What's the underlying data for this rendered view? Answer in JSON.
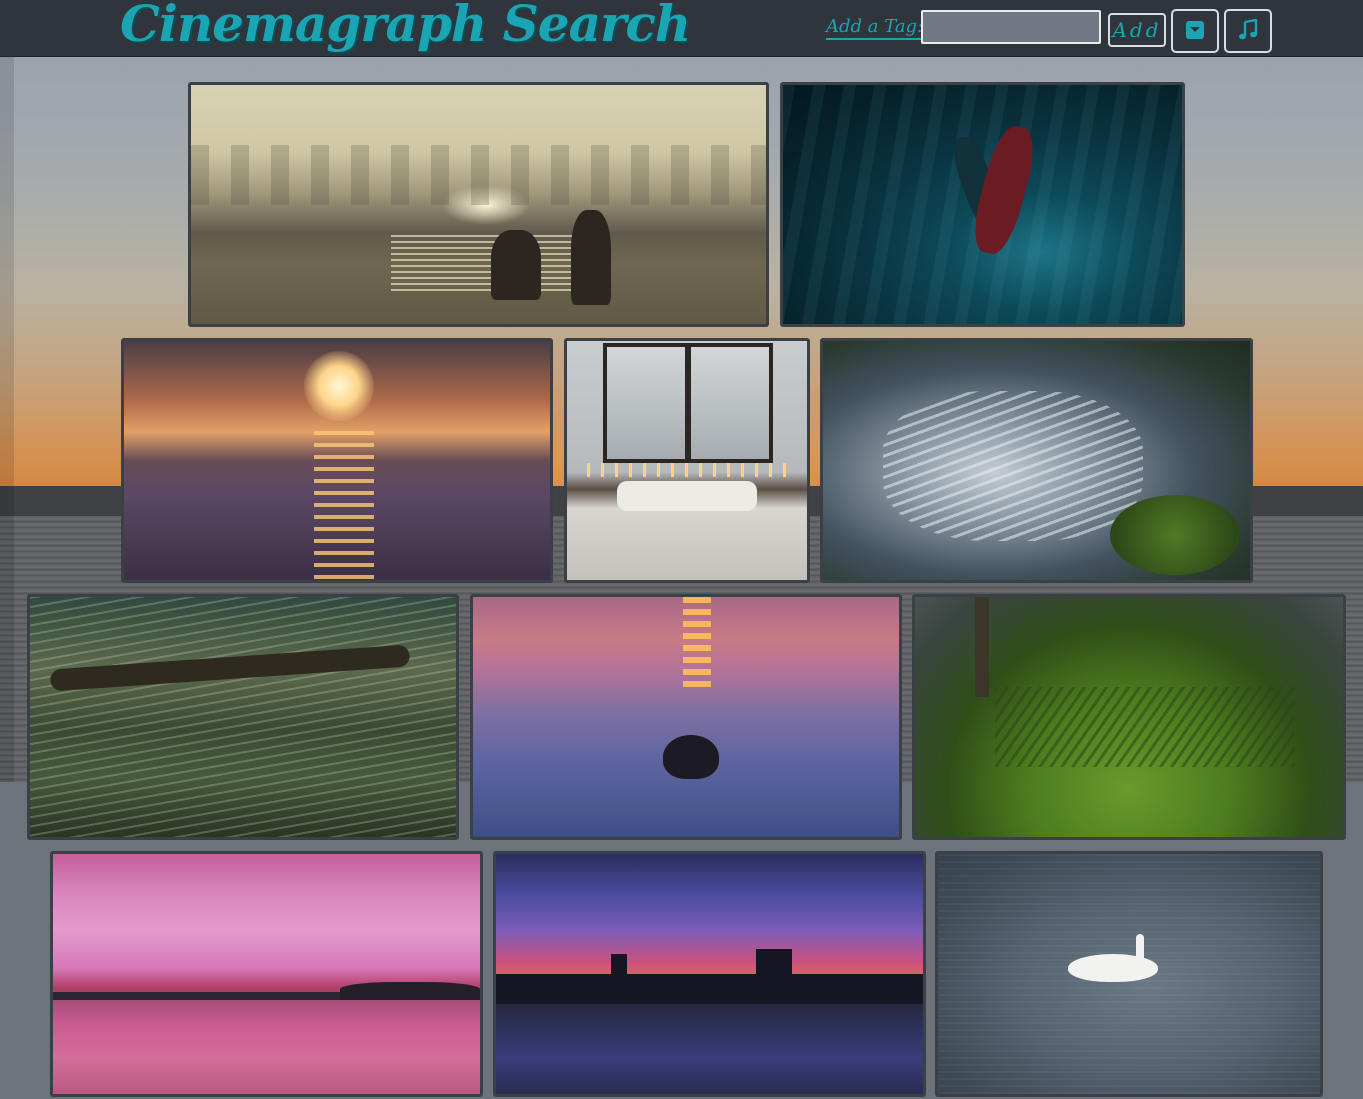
{
  "header": {
    "logo": "Cinemagraph Search",
    "tag_label": "Add a Tag:",
    "tag_input_value": "",
    "tag_input_placeholder": "",
    "add_button_label": "Add",
    "dropdown_icon": "caret-down-square-icon",
    "music_icon": "music-note-icon"
  },
  "colors": {
    "accent": "#1aa5b5",
    "header_bg": "#30353b",
    "tile_border": "#3b4047"
  },
  "gallery": {
    "rows": [
      [
        {
          "subject": "beach-sunset-couple"
        },
        {
          "subject": "underwater-embrace"
        }
      ],
      [
        {
          "subject": "sunset-waves"
        },
        {
          "subject": "rainy-bedroom-window"
        },
        {
          "subject": "mossy-waterfall"
        }
      ],
      [
        {
          "subject": "rushing-stream"
        },
        {
          "subject": "rock-in-violet-lake"
        },
        {
          "subject": "forest-ferns"
        }
      ],
      [
        {
          "subject": "pink-sky-reflection"
        },
        {
          "subject": "city-skyline-sunset"
        },
        {
          "subject": "swan-on-water"
        }
      ]
    ]
  }
}
